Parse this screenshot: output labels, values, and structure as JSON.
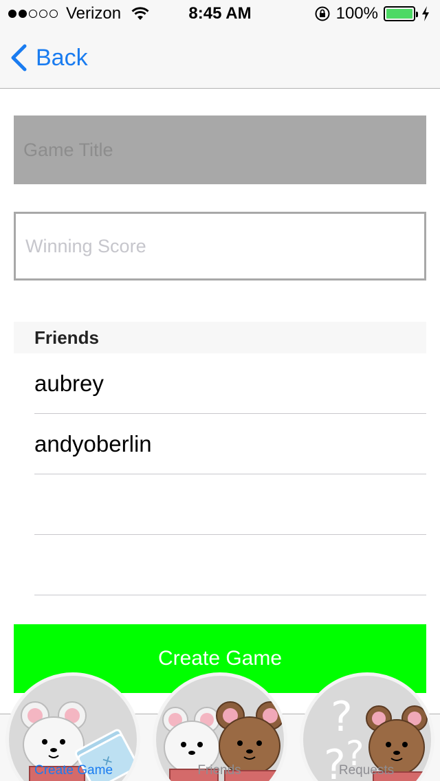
{
  "status_bar": {
    "carrier": "Verizon",
    "time": "8:45 AM",
    "battery": "100%",
    "signal_filled": 2,
    "signal_total": 5
  },
  "nav": {
    "back_label": "Back"
  },
  "form": {
    "title_placeholder": "Game Title",
    "score_placeholder": "Winning Score"
  },
  "friends": {
    "header": "Friends",
    "items": [
      "aubrey",
      "andyoberlin",
      "",
      ""
    ]
  },
  "create_button_label": "Create Game",
  "tabs": [
    {
      "label": "Create Game",
      "active": true
    },
    {
      "label": "Friends",
      "active": false
    },
    {
      "label": "Requests",
      "active": false
    }
  ],
  "colors": {
    "accent": "#1a7cf0",
    "create_button": "#00ff00",
    "title_field": "#a8a8a8",
    "battery": "#4cd964"
  }
}
